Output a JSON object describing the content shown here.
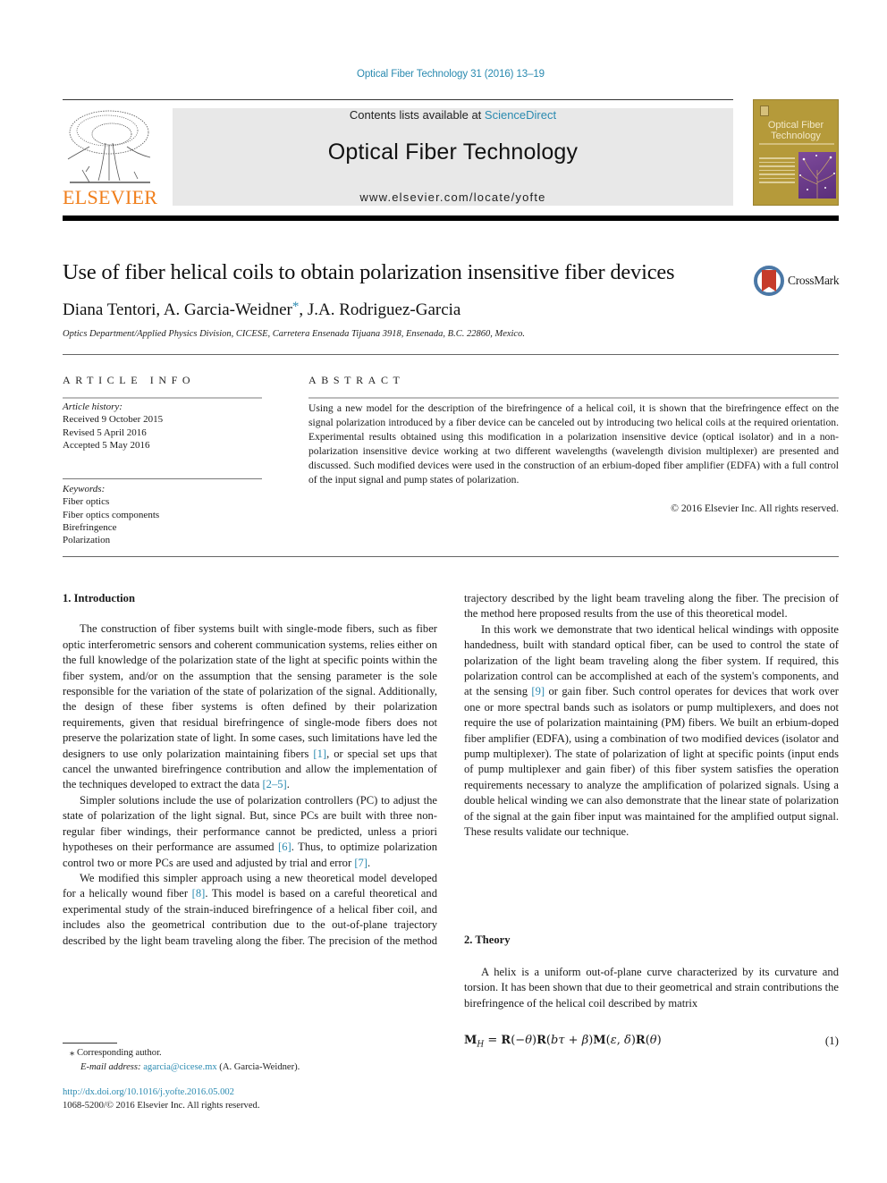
{
  "header": {
    "journal_ref": "Optical Fiber Technology 31 (2016) 13–19",
    "contents_prefix": "Contents lists available at ",
    "contents_link": "ScienceDirect",
    "journal_title": "Optical Fiber Technology",
    "journal_url": "www.elsevier.com/locate/yofte",
    "publisher_logo_text": "ELSEVIER",
    "cover": {
      "title_line1": "Optical Fiber",
      "title_line2": "Technology"
    },
    "colors": {
      "link": "#2a8ab0",
      "elsevier_orange": "#f07e1a",
      "cover_gold": "#b59a3a",
      "cover_purple": "#6b3c8b"
    }
  },
  "article": {
    "title": "Use of fiber helical coils to obtain polarization insensitive fiber devices",
    "crossmark_label": "CrossMark",
    "authors": {
      "a1": "Diana Tentori, ",
      "a2": "A. Garcia-Weidner",
      "a2_mark": "*",
      "a3": ", J.A. Rodriguez-Garcia"
    },
    "affiliation": "Optics Department/Applied Physics Division, CICESE, Carretera Ensenada Tijuana 3918, Ensenada, B.C. 22860, Mexico."
  },
  "article_info": {
    "label": "ARTICLE INFO",
    "history_head": "Article history:",
    "history": [
      "Received 9 October 2015",
      "Revised 5 April 2016",
      "Accepted 5 May 2016"
    ],
    "keywords_head": "Keywords:",
    "keywords": [
      "Fiber optics",
      "Fiber optics components",
      "Birefringence",
      "Polarization"
    ]
  },
  "abstract": {
    "label": "ABSTRACT",
    "text": "Using a new model for the description of the birefringence of a helical coil, it is shown that the birefringence effect on the signal polarization introduced by a fiber device can be canceled out by introducing two helical coils at the required orientation. Experimental results obtained using this modification in a polarization insensitive device (optical isolator) and in a non-polarization insensitive device working at two different wavelengths (wavelength division multiplexer) are presented and discussed. Such modified devices were used in the construction of an erbium-doped fiber amplifier (EDFA) with a full control of the input signal and pump states of polarization.",
    "copyright": "© 2016 Elsevier Inc. All rights reserved."
  },
  "body": {
    "intro_heading": "1. Introduction",
    "p1_a": "The construction of fiber systems built with single-mode fibers, such as fiber optic interferometric sensors and coherent communication systems, relies either on the full knowledge of the polarization state of the light at specific points within the fiber system, and/or on the assumption that the sensing parameter is the sole responsible for the variation of the state of polarization of the signal. Additionally, the design of these fiber systems is often defined by their polarization requirements, given that residual birefringence of single-mode fibers does not preserve the polarization state of light. In some cases, such limitations have led the designers to use only polarization maintaining fibers ",
    "ref1": "[1]",
    "p1_b": ", or special set ups that cancel the unwanted birefringence contribution and allow the implementation of the techniques developed to extract the data ",
    "ref2_5": "[2–5]",
    "p1_c": ".",
    "p2_a": "Simpler solutions include the use of polarization controllers (PC) to adjust the state of polarization of the light signal. But, since PCs are built with three non-regular fiber windings, their performance cannot be predicted, unless a priori hypotheses on their performance are assumed ",
    "ref6": "[6]",
    "p2_b": ". Thus, to optimize polarization control two or more PCs are used and adjusted by trial and error ",
    "ref7": "[7]",
    "p2_c": ".",
    "p3_a": "We modified this simpler approach using a new theoretical model developed for a helically wound fiber ",
    "ref8": "[8]",
    "p3_b": ". This model is based on a careful theoretical and experimental study of the strain-induced birefringence of a helical fiber coil, and includes also the geometrical contribution due to the out-of-plane trajectory described by the light beam traveling along the fiber. The precision of the method here proposed results from the use of this theoretical model.",
    "p4_a": "In this work we demonstrate that two identical helical windings with opposite handedness, built with standard optical fiber, can be used to control the state of polarization of the light beam traveling along the fiber system. If required, this polarization control can be accomplished at each of the system's components, and at the sensing ",
    "ref9": "[9]",
    "p4_b": " or gain fiber. Such control operates for devices that work over one or more spectral bands such as isolators or pump multiplexers, and does not require the use of polarization maintaining (PM) fibers. We built an erbium-doped fiber amplifier (EDFA), using a combination of two modified devices (isolator and pump multiplexer). The state of polarization of light at specific points (input ends of pump multiplexer and gain fiber) of this fiber system satisfies the operation requirements necessary to analyze the amplification of polarized signals. Using a double helical winding we can also demonstrate that the linear state of polarization of the signal at the gain fiber input was maintained for the amplified output signal. These results validate our technique.",
    "theory_heading": "2. Theory",
    "theory_p": "A helix is a uniform out-of-plane curve characterized by its curvature and torsion. It has been shown that due to their geometrical and strain contributions the birefringence of the helical coil described by matrix",
    "equation": "M_H = R(−θ)R(bτ + β)M(ε, δ)R(θ)",
    "equation_number": "(1)"
  },
  "footnotes": {
    "corresponding": "⁎ Corresponding author.",
    "email_label": "E-mail address: ",
    "email": "agarcia@cicese.mx",
    "email_suffix": " (A. Garcia-Weidner).",
    "doi": "http://dx.doi.org/10.1016/j.yofte.2016.05.002",
    "issn": "1068-5200/© 2016 Elsevier Inc. All rights reserved."
  }
}
